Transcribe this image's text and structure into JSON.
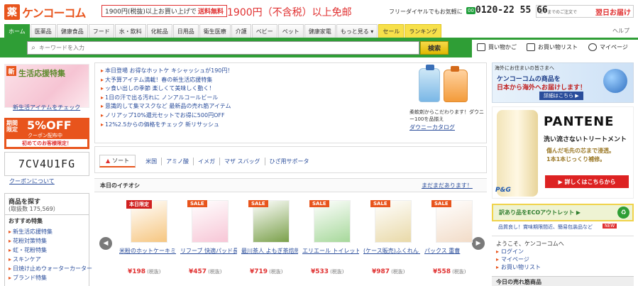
{
  "header": {
    "logo_kanji": "薬",
    "logo_text": "ケンコーコム",
    "promo_small": "1900円(税抜)以上お買い上げで",
    "promo_red": "送料無料",
    "promo_big": "1900円（不含税）以上免邮",
    "freedial_label": "フリーダイヤルでもお気軽に",
    "freedial_badge": "00",
    "freedial_number": "0120-22 55 66",
    "delivery_small": "正午までのご注文で",
    "delivery_big": "翌日お届け",
    "help": "ヘルプ"
  },
  "nav": {
    "tabs": [
      "ホーム",
      "医薬品",
      "健康食品",
      "フード",
      "水・飲料",
      "化粧品",
      "日用品",
      "衛生医療",
      "介護",
      "ベビー",
      "ペット",
      "健康家電",
      "もっと見る ▾",
      "セール",
      "ランキング"
    ]
  },
  "search": {
    "placeholder": "キーワードを入力",
    "button": "検索",
    "cart": "買い物かご",
    "wishlist": "お買い物リスト",
    "mypage": "マイページ"
  },
  "left": {
    "banner_badge": "新",
    "banner_title": "生活応援特集",
    "banner_caption": "新生活アイテムをチェック",
    "coupon_limited": "期間限定",
    "coupon_pct": "5%OFF",
    "coupon_sub": "クーポン配布中",
    "coupon_bar": "初めてのお客様限定！",
    "coupon_code": "7CV4U1FG",
    "coupon_link": "クーポンについて",
    "browse_title": "商品を探す",
    "browse_count": "(取扱数 175,569）",
    "recommend_title": "おすすめ特集",
    "recommend_items": [
      "新生活応援特集",
      "花粉対策特集",
      "虹・花粉特集",
      "スキンケア",
      "日焼け止めウォーターカーター",
      "ブランド特集"
    ]
  },
  "news": [
    "本日登場 お得なホットケ キシャッシュが190円！",
    "大予算アイテム満載！春の新生活応援特集",
    "ッ食い出しの季節 楽しくて美味しく動く！",
    "1日の汗で出る汚れに ノンアルコールビール",
    "意識的して集マスクなど 最新品の売れ筋アイテム",
    "ノリアップ10%還元セットでお得に500円OFF",
    "12%2.5からの価格をチェック 新リサッシュ"
  ],
  "downy": {
    "text": "柔軟剤からこだわります！ダウニー100を品揃え",
    "link": "ダウニーカタログ"
  },
  "tags": {
    "sort_label": "ソート",
    "items": [
      "米国",
      "アミノ酸",
      "イメガ",
      "マザ スバッグ",
      "ひざ用サポータ"
    ]
  },
  "recommendation": {
    "title": "本日のイチオシ",
    "more": "まだまだあります！",
    "products": [
      {
        "badge": "本日限定",
        "name": "米粉のホットケーキミックス",
        "price": "¥198",
        "tax": "(税抜)",
        "color": "#f6c680"
      },
      {
        "badge": "SALE",
        "name": "リフーブ 快適パッド長時間用",
        "price": "¥457",
        "tax": "(税抜)",
        "color": "#f7c6d6"
      },
      {
        "badge": "SALE",
        "name": "最川茶人 よもぎ茶焙煎パック",
        "price": "¥719",
        "tax": "(税抜)",
        "color": "#7aa04a"
      },
      {
        "badge": "SALE",
        "name": "エリエール トイレットティシュー",
        "price": "¥533",
        "tax": "(税抜)",
        "color": "#a6d89a"
      },
      {
        "badge": "SALE",
        "name": "(ケース販売)ふくれん 豆乳飲料",
        "price": "¥987",
        "tax": "(税抜)",
        "color": "#e9d9a8"
      },
      {
        "badge": "SALE",
        "name": "パックス 重曹",
        "price": "¥558",
        "tax": "(税抜)",
        "color": "#f2dcc8"
      }
    ]
  },
  "right": {
    "overseas_label": "海外にお住まいの皆さまへ",
    "overseas_t1": "ケンコーコムの商品を",
    "overseas_t2": "日本から海外へお届けします！",
    "overseas_btn": "詳細はこちら ▶",
    "pantene_brand": "PANTENE",
    "pantene_tagline": "洗い流さないトリートメント",
    "pantene_copy1": "傷んだ毛先の芯まで浸透。",
    "pantene_copy2": "1本1本じっくり補修。",
    "pantene_cta": "▶ 詳しくはこちらから",
    "pantene_pg": "P&G",
    "eco_text": "訳あり品をECOアウトレット ▶",
    "eco_sub": "品質良し！賞味期限間近、簡易包装品など",
    "eco_new": "NEW",
    "welcome": "ようこそ、ケンコーコムへ",
    "member_links": [
      "ログイン",
      "マイページ",
      "お買い物リスト"
    ],
    "bestsell": "今日の売れ筋商品"
  }
}
